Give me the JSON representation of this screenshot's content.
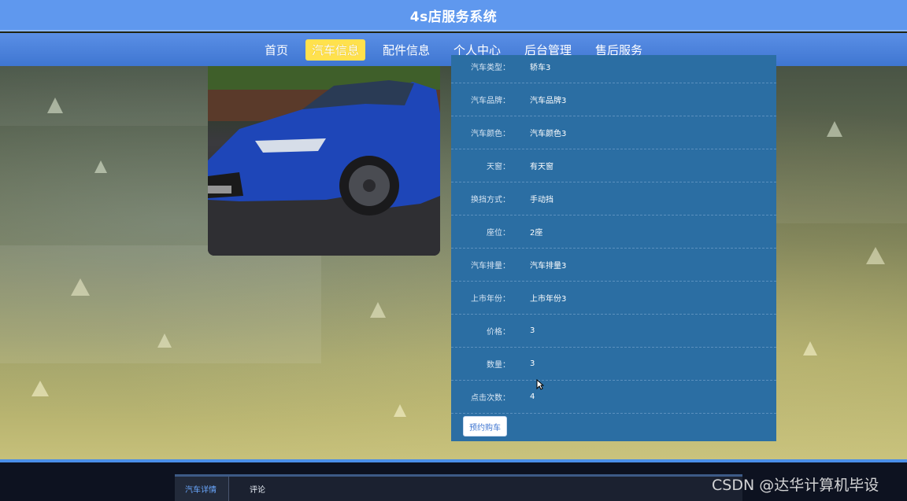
{
  "header": {
    "title": "4s店服务系统"
  },
  "nav": {
    "items": [
      {
        "label": "首页"
      },
      {
        "label": "汽车信息"
      },
      {
        "label": "配件信息"
      },
      {
        "label": "个人中心"
      },
      {
        "label": "后台管理"
      },
      {
        "label": "售后服务"
      }
    ]
  },
  "details": [
    {
      "label": "汽车类型：",
      "value": "轿车3"
    },
    {
      "label": "汽车品牌：",
      "value": "汽车品牌3"
    },
    {
      "label": "汽车颜色：",
      "value": "汽车颜色3"
    },
    {
      "label": "天窗：",
      "value": "有天窗"
    },
    {
      "label": "换挡方式：",
      "value": "手动挡"
    },
    {
      "label": "座位：",
      "value": "2座"
    },
    {
      "label": "汽车排量：",
      "value": "汽车排量3"
    },
    {
      "label": "上市年份：",
      "value": "上市年份3"
    },
    {
      "label": "价格：",
      "value": "3"
    },
    {
      "label": "数量：",
      "value": "3"
    },
    {
      "label": "点击次数：",
      "value": "4"
    }
  ],
  "actions": {
    "book_label": "预约购车"
  },
  "tabs": [
    {
      "label": "汽车详情"
    },
    {
      "label": "评论"
    }
  ],
  "watermark": "CSDN @达华计算机毕设",
  "colors": {
    "primary": "#5f98ee",
    "nav_active": "#ffe14d",
    "panel": "#2b6ea3"
  }
}
